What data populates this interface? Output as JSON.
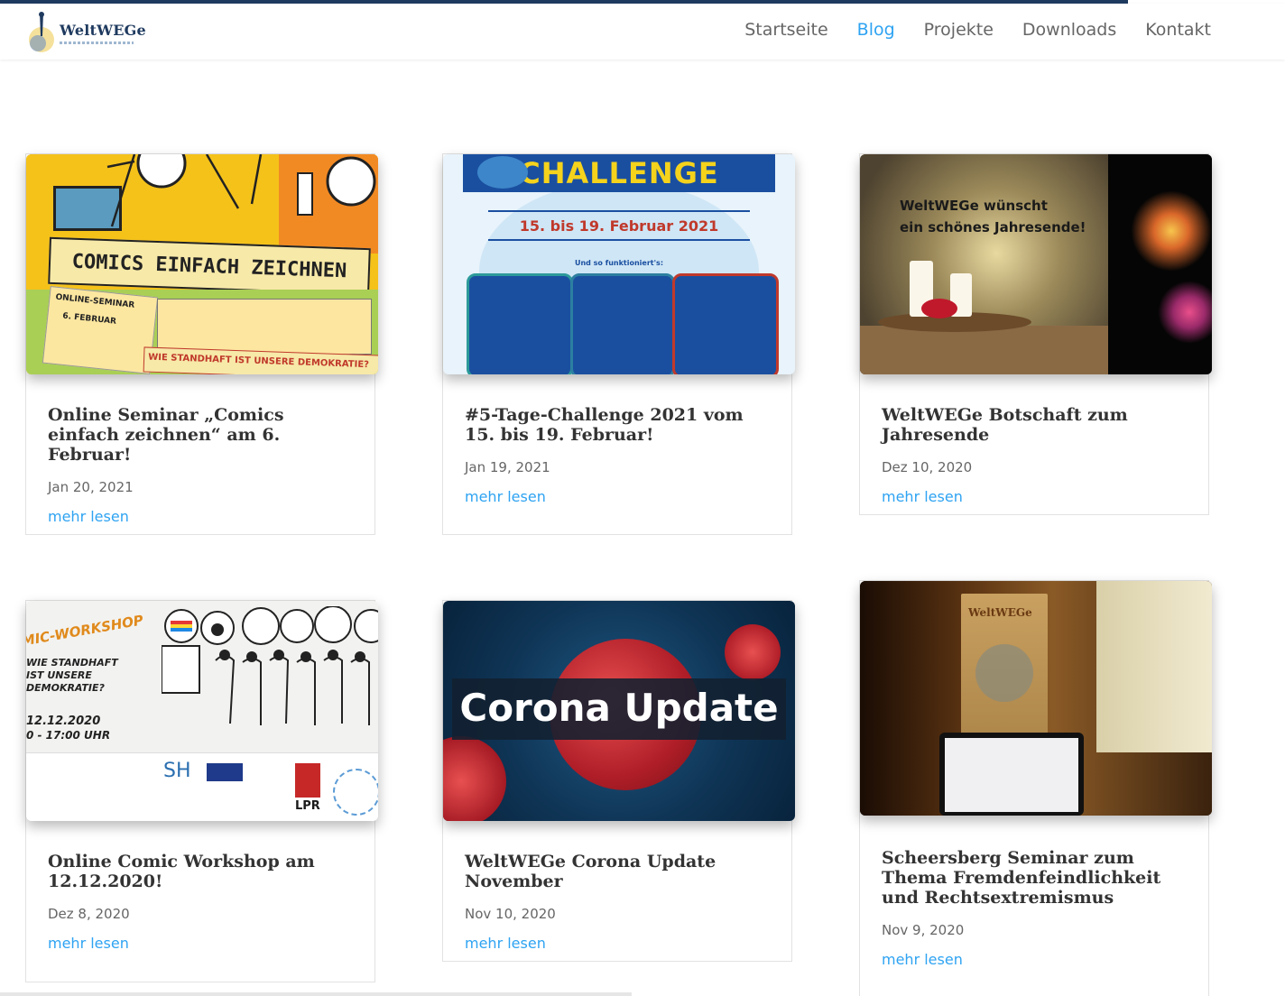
{
  "site": {
    "name": "WeltWEGe"
  },
  "nav": {
    "items": [
      "Startseite",
      "Blog",
      "Projekte",
      "Downloads",
      "Kontakt"
    ],
    "active": "Blog"
  },
  "colors": {
    "accent": "#2ea3f2",
    "brand": "#1f3a5f",
    "text": "#333333",
    "muted": "#666666"
  },
  "posts": [
    {
      "title": "Online Seminar „Comics einfach zeichnen“ am 6. Februar!",
      "date": "Jan 20, 2021",
      "more": "mehr lesen",
      "image": {
        "headline": "COMICS EINFACH ZEICHNEN",
        "line1": "ONLINE-SEMINAR",
        "line2": "6. FEBRUAR",
        "line3": "WIE STANDHAFT IST UNSERE DEMOKRATIE?"
      }
    },
    {
      "title": "#5-Tage-Challenge 2021 vom 15. bis 19. Februar!",
      "date": "Jan 19, 2021",
      "more": "mehr lesen",
      "image": {
        "headline": "CHALLENGE",
        "dates": "15. bis 19. Februar 2021",
        "sub": "Und so funktioniert's:"
      }
    },
    {
      "title": "WeltWEGe Botschaft zum Jahresende",
      "date": "Dez 10, 2020",
      "more": "mehr lesen",
      "image": {
        "line1": "WeltWEGe wünscht",
        "line2": "ein schönes Jahresende!"
      }
    },
    {
      "title": "Online Comic Workshop am 12.12.2020!",
      "date": "Dez 8, 2020",
      "more": "mehr lesen",
      "image": {
        "headline": "MIC-WORKSHOP",
        "line1": "WIE STANDHAFT IST UNSERE DEMOKRATIE?",
        "line2": "12.12.2020",
        "line3": "0 - 17:00 UHR",
        "logo1": "SH",
        "logo2": "LPR"
      }
    },
    {
      "title": "WeltWEGe Corona Update November",
      "date": "Nov 10, 2020",
      "more": "mehr lesen",
      "image": {
        "headline": "Corona Update"
      }
    },
    {
      "title": "Scheersberg Seminar zum Thema Fremdenfeindlichkeit und Rechtsextremismus",
      "date": "Nov 9, 2020",
      "more": "mehr lesen",
      "image": {
        "banner": "WeltWEGe"
      }
    }
  ]
}
